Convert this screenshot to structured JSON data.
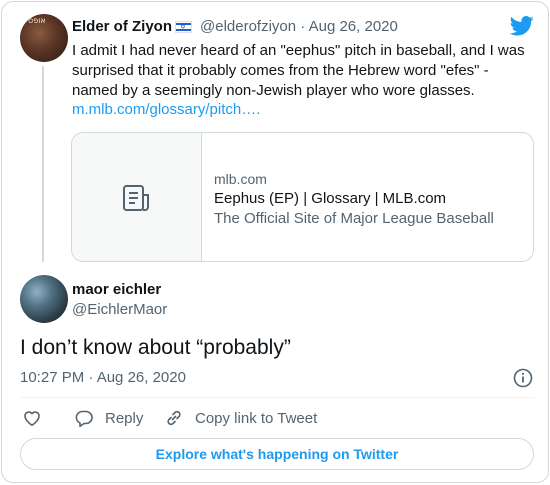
{
  "quoted_tweet": {
    "avatar_text": "אופס",
    "author_name": "Elder of Ziyon",
    "handle_date": "@elderofziyon · Aug 26, 2020",
    "text": "I admit I had never heard of an \"eephus\" pitch in baseball, and I was surprised that it probably comes from the Hebrew word \"efes\" - named by a seemingly non-Jewish player who wore glasses.",
    "link": "m.mlb.com/glossary/pitch….",
    "card": {
      "domain": "mlb.com",
      "title": "Eephus (EP) | Glossary | MLB.com",
      "description": "The Official Site of Major League Baseball"
    }
  },
  "reply": {
    "author_name": "maor eichler",
    "handle": "@EichlerMaor",
    "text": "I don’t know about “probably”",
    "timestamp": "10:27 PM · Aug 26, 2020"
  },
  "actions": {
    "reply_label": "Reply",
    "copy_label": "Copy link to Tweet"
  },
  "explore_label": "Explore what's happening on Twitter",
  "colors": {
    "accent": "#1d9bf0",
    "text_primary": "#0f1419",
    "text_secondary": "#536471",
    "border": "#cfd9de"
  },
  "icons": [
    "twitter-logo-icon",
    "israel-flag-icon",
    "document-icon",
    "info-icon",
    "heart-icon",
    "reply-icon",
    "link-icon"
  ]
}
